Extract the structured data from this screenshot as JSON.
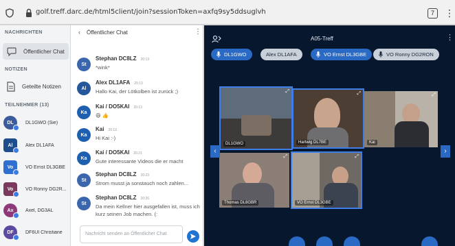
{
  "browser": {
    "url": "golf.treff.darc.de/html5client/join?sessionToken=axfq9sy5ddsuglvh",
    "tab_count": "7"
  },
  "nav": {
    "messages_heading": "NACHRICHTEN",
    "public_chat_label": "Öffentlicher Chat",
    "notes_heading": "NOTIZEN",
    "shared_notes_label": "Geteilte Notizen",
    "participants_heading": "TEILNEHMER (13)",
    "users": [
      {
        "initials": "DL",
        "name": "DL1GWO (Sie)",
        "color": "#3b5b9c"
      },
      {
        "initials": "Al",
        "name": "Alex DL1AFA",
        "color": "#1e4d8c"
      },
      {
        "initials": "Vo",
        "name": "VO Ernst DL3GBE",
        "color": "#2f6fd1"
      },
      {
        "initials": "Vo",
        "name": "VO Ronny DG2R...",
        "color": "#7a3a5d"
      },
      {
        "initials": "Ax",
        "name": "Axel, DG3AL",
        "color": "#8e3a7a"
      },
      {
        "initials": "DF",
        "name": "DF6UI Christiane",
        "color": "#5b4aa0"
      }
    ]
  },
  "chat": {
    "title": "Öffentlicher Chat",
    "input_placeholder": "Nachricht senden an Öffentlicher Chat",
    "messages": [
      {
        "initials": "St",
        "name": "Stephan DC8LZ",
        "time": "20:13",
        "text": "*wink*",
        "color": "#3a66ad"
      },
      {
        "initials": "Al",
        "name": "Alex DL1AFA",
        "time": "20:13",
        "text": "Hallo Kai, der Lötkolben ist zurück ;)",
        "color": "#24579c"
      },
      {
        "initials": "Ka",
        "name": "Kai / DO5KAI",
        "time": "20:13",
        "text": "😄 👍",
        "color": "#1f5fb0"
      },
      {
        "initials": "Ka",
        "name": "Kai",
        "time": "20:13",
        "text": "Hi Kai :-)",
        "color": "#1f5fb0"
      },
      {
        "initials": "Ka",
        "name": "Kai / DO5KAI",
        "time": "20:21",
        "text": "Gute interessante Videos die er macht",
        "color": "#1f5fb0"
      },
      {
        "initials": "St",
        "name": "Stephan DC8LZ",
        "time": "20:23",
        "text": "Strom musst ja sonstauch noch zahlen...",
        "color": "#3a66ad"
      },
      {
        "initials": "St",
        "name": "Stephan DC8LZ",
        "time": "20:26",
        "text": "Da mein Kellner hier ausgefallen ist, muss ich kurz seinen Job machen. (:",
        "color": "#3a66ad"
      }
    ]
  },
  "meeting": {
    "title": "A05-Treff",
    "talkers": [
      {
        "label": "DL1GWO",
        "style": "blue"
      },
      {
        "label": "Alex DL1AFA",
        "style": "grey"
      },
      {
        "label": "VO Ernst DL3GBE",
        "style": "blue"
      },
      {
        "label": "VO Ronny DG2RON",
        "style": "grey"
      }
    ],
    "tiles": [
      {
        "label": "DL1GWO"
      },
      {
        "label": "Hartwig DL7BE"
      },
      {
        "label": "Kai"
      },
      {
        "label": "Thomas DL8GBR"
      },
      {
        "label": "VO Ernst DL3GBE"
      }
    ]
  }
}
